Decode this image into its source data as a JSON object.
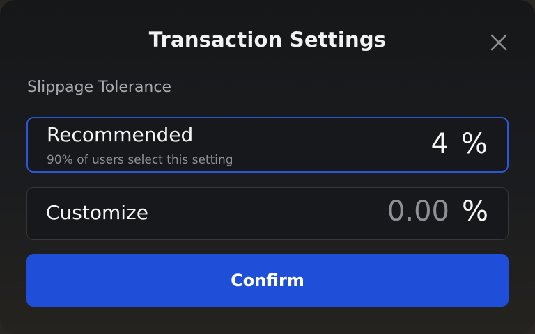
{
  "modal": {
    "title": "Transaction Settings",
    "close_icon": "close-icon",
    "section_label": "Slippage Tolerance",
    "options": [
      {
        "label": "Recommended",
        "subtext": "90% of users select this setting",
        "value": "4",
        "unit": "%",
        "selected": true
      },
      {
        "label": "Customize",
        "placeholder": "0.00",
        "unit": "%",
        "selected": false
      }
    ],
    "confirm_label": "Confirm"
  },
  "colors": {
    "accent": "#1f4fd8",
    "selected_border": "#2a57d6",
    "background": "#17181b",
    "muted_text": "#8f9095"
  }
}
